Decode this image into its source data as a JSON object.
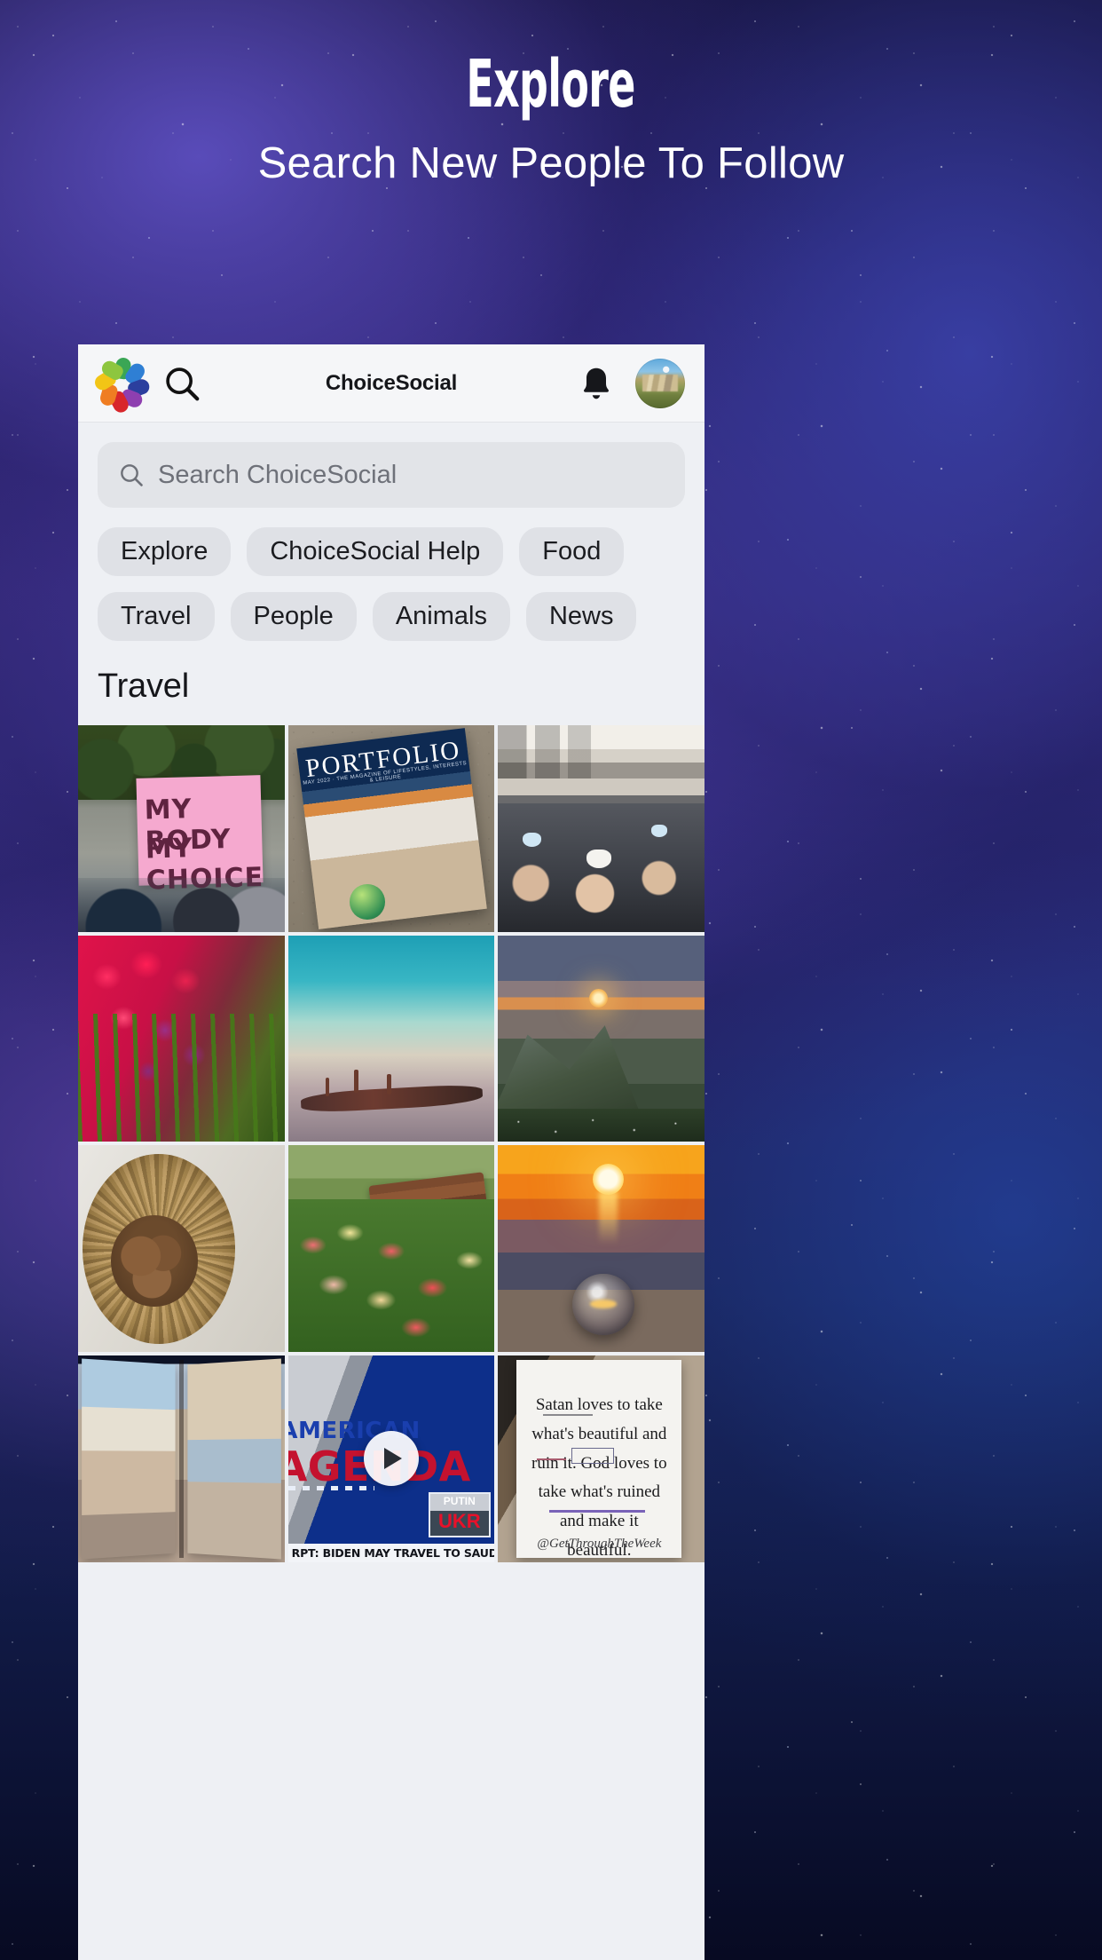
{
  "hero": {
    "title": "Explore",
    "subtitle": "Search New People To Follow"
  },
  "app": {
    "header": {
      "title": "ChoiceSocial",
      "logo_icon": "choicesocial-people-logo",
      "search_icon": "search-icon",
      "bell_icon": "bell-icon",
      "avatar_icon": "user-avatar"
    },
    "search": {
      "placeholder": "Search ChoiceSocial",
      "value": "",
      "icon": "search-icon"
    },
    "chips": [
      {
        "label": "Explore"
      },
      {
        "label": "ChoiceSocial Help"
      },
      {
        "label": "Food"
      },
      {
        "label": "Travel"
      },
      {
        "label": "People"
      },
      {
        "label": "Animals"
      },
      {
        "label": "News"
      }
    ],
    "section_title": "Travel",
    "grid": [
      {
        "name": "protest-sign-post",
        "kind": "image",
        "sign_line1": "MY BODY",
        "sign_line2": "MY CHOICE"
      },
      {
        "name": "portfolio-magazine-post",
        "kind": "image",
        "magazine_title": "PORTFOLIO",
        "magazine_subtitle": "MAY 2022  ·  THE MAGAZINE OF LIFESTYLES, INTERESTS & LEISURE"
      },
      {
        "name": "airplane-cabin-post",
        "kind": "image"
      },
      {
        "name": "red-tulips-post",
        "kind": "image"
      },
      {
        "name": "teal-sea-driftwood-post",
        "kind": "image"
      },
      {
        "name": "mountain-sunset-post",
        "kind": "image"
      },
      {
        "name": "bird-nest-post",
        "kind": "image"
      },
      {
        "name": "park-bench-tulips-post",
        "kind": "image"
      },
      {
        "name": "ocean-sunset-lensball-post",
        "kind": "image"
      },
      {
        "name": "magazine-spread-post",
        "kind": "image"
      },
      {
        "name": "news-broadcast-video-post",
        "kind": "video",
        "show_line1": "AMERICAN",
        "show_line2": "AGENDA",
        "chyron": "RPT: BIDEN MAY TRAVEL TO SAUDI ARABIA FOR OIL DEAL",
        "corner_line1": "PUTIN",
        "corner_line2": "UKR",
        "play_icon": "play-icon"
      },
      {
        "name": "quote-card-post",
        "kind": "image",
        "quote": "Satan loves to take what's beautiful and ruin it. God loves to take what's ruined and make it beautiful.",
        "handle": "@GetThroughTheWeek"
      }
    ]
  },
  "colors": {
    "app_bg": "#eef0f4",
    "appbar_bg": "#f5f6f8",
    "chip_bg": "#dfe1e6",
    "search_bg": "#e2e4e8",
    "text_primary": "#15161a",
    "text_muted": "#6e7179",
    "hero_text": "#ffffff"
  }
}
